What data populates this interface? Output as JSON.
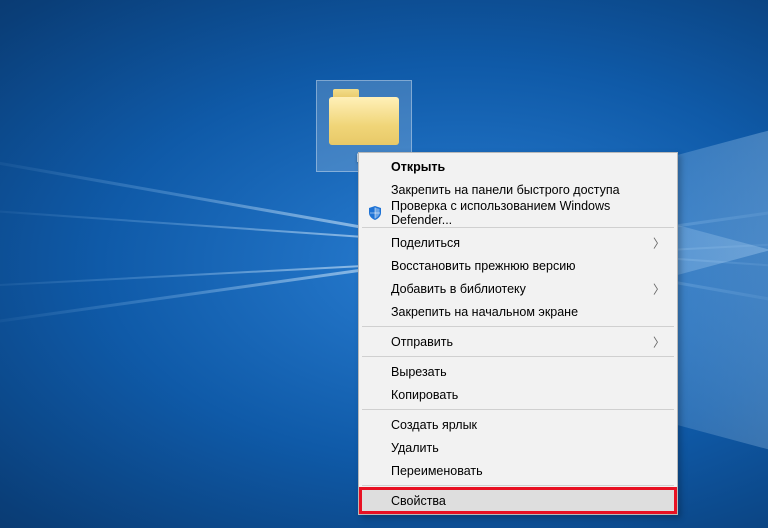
{
  "folder": {
    "label": "Но"
  },
  "context_menu": {
    "items": [
      {
        "label": "Открыть",
        "bold": true
      },
      {
        "label": "Закрепить на панели быстрого доступа"
      },
      {
        "label": "Проверка с использованием Windows Defender...",
        "icon": "shield"
      }
    ],
    "group2": [
      {
        "label": "Поделиться",
        "submenu": true
      },
      {
        "label": "Восстановить прежнюю версию"
      },
      {
        "label": "Добавить в библиотеку",
        "submenu": true
      },
      {
        "label": "Закрепить на начальном экране"
      }
    ],
    "group3": [
      {
        "label": "Отправить",
        "submenu": true
      }
    ],
    "group4": [
      {
        "label": "Вырезать"
      },
      {
        "label": "Копировать"
      }
    ],
    "group5": [
      {
        "label": "Создать ярлык"
      },
      {
        "label": "Удалить"
      },
      {
        "label": "Переименовать"
      }
    ],
    "group6": [
      {
        "label": "Свойства",
        "highlighted": true
      }
    ]
  },
  "colors": {
    "highlight_box": "#e81123",
    "menu_bg": "#f2f2f2",
    "menu_border": "#b9b9b9"
  }
}
